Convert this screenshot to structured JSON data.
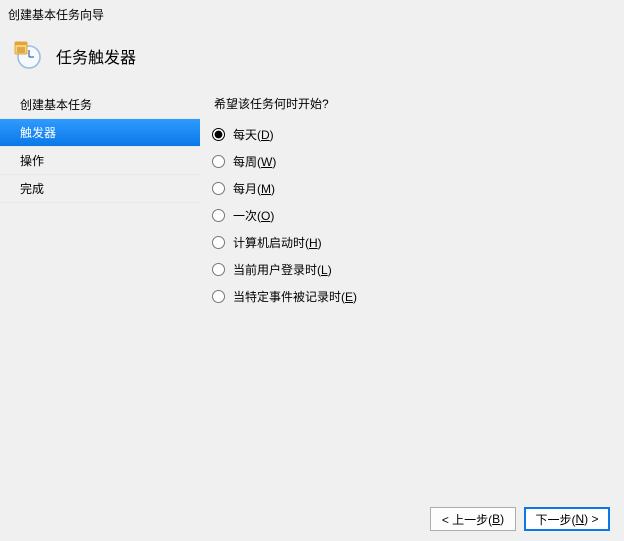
{
  "window_title": "创建基本任务向导",
  "header": {
    "title": "任务触发器"
  },
  "sidebar": {
    "items": [
      {
        "label": "创建基本任务",
        "selected": false
      },
      {
        "label": "触发器",
        "selected": true
      },
      {
        "label": "操作",
        "selected": false
      },
      {
        "label": "完成",
        "selected": false
      }
    ]
  },
  "main": {
    "prompt": "希望该任务何时开始?",
    "options": [
      {
        "text": "每天",
        "accel": "D",
        "checked": true
      },
      {
        "text": "每周",
        "accel": "W",
        "checked": false
      },
      {
        "text": "每月",
        "accel": "M",
        "checked": false
      },
      {
        "text": "一次",
        "accel": "O",
        "checked": false
      },
      {
        "text": "计算机启动时",
        "accel": "H",
        "checked": false
      },
      {
        "text": "当前用户登录时",
        "accel": "L",
        "checked": false
      },
      {
        "text": "当特定事件被记录时",
        "accel": "E",
        "checked": false
      }
    ]
  },
  "footer": {
    "back": {
      "prefix": "< 上一步(",
      "accel": "B",
      "suffix": ")"
    },
    "next": {
      "prefix": "下一步(",
      "accel": "N",
      "suffix": ") >"
    }
  }
}
